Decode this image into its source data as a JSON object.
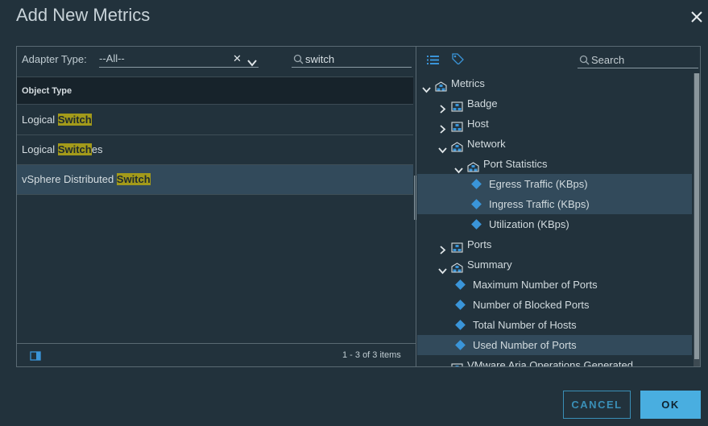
{
  "dialog": {
    "title": "Add New Metrics",
    "close_icon": "close-icon"
  },
  "left_panel": {
    "adapter_label": "Adapter Type:",
    "adapter_value": "--All--",
    "search_value": "switch",
    "column_header": "Object Type",
    "rows": [
      {
        "pre": "Logical ",
        "match": "Switch",
        "post": "",
        "selected": false
      },
      {
        "pre": "Logical ",
        "match": "Switch",
        "post": "es",
        "selected": false
      },
      {
        "pre": "vSphere Distributed ",
        "match": "Switch",
        "post": "",
        "selected": true
      }
    ],
    "footer_count": "1 - 3 of 3 items"
  },
  "right_panel": {
    "search_placeholder": "Search",
    "tree": [
      {
        "label": "Metrics",
        "expanded": true,
        "type": "group",
        "selected": false
      },
      {
        "label": "Badge",
        "expanded": false,
        "type": "group",
        "selected": false
      },
      {
        "label": "Host",
        "expanded": false,
        "type": "group",
        "selected": false
      },
      {
        "label": "Network",
        "expanded": true,
        "type": "group",
        "selected": false
      },
      {
        "label": "Port Statistics",
        "expanded": true,
        "type": "group",
        "selected": false
      },
      {
        "label": "Egress Traffic (KBps)",
        "type": "metric",
        "selected": true
      },
      {
        "label": "Ingress Traffic (KBps)",
        "type": "metric",
        "selected": true
      },
      {
        "label": "Utilization (KBps)",
        "type": "metric",
        "selected": false
      },
      {
        "label": "Ports",
        "expanded": false,
        "type": "group",
        "selected": false
      },
      {
        "label": "Summary",
        "expanded": true,
        "type": "group",
        "selected": false
      },
      {
        "label": "Maximum Number of Ports",
        "type": "metric",
        "selected": false
      },
      {
        "label": "Number of Blocked Ports",
        "type": "metric",
        "selected": false
      },
      {
        "label": "Total Number of Hosts",
        "type": "metric",
        "selected": false
      },
      {
        "label": "Used Number of Ports",
        "type": "metric",
        "selected": true
      },
      {
        "label": "VMware Aria Operations Generated",
        "expanded": false,
        "type": "group",
        "selected": false
      }
    ]
  },
  "buttons": {
    "cancel": "CANCEL",
    "ok": "OK"
  },
  "colors": {
    "background": "#22323c",
    "selection": "#324a5b",
    "highlight": "#a39a1a",
    "accent": "#49aee0"
  }
}
